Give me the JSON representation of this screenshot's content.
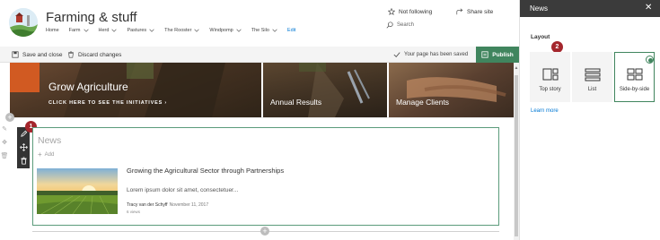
{
  "site": {
    "title": "Farming & stuff",
    "nav": [
      {
        "label": "Home",
        "has_dropdown": false
      },
      {
        "label": "Farm",
        "has_dropdown": true
      },
      {
        "label": "Herd",
        "has_dropdown": true
      },
      {
        "label": "Pastures",
        "has_dropdown": true
      },
      {
        "label": "The Rooster",
        "has_dropdown": true
      },
      {
        "label": "Windpomp",
        "has_dropdown": true
      },
      {
        "label": "The Silo",
        "has_dropdown": true
      },
      {
        "label": "Edit",
        "has_dropdown": false
      }
    ],
    "follow_label": "Not following",
    "share_label": "Share site",
    "search_placeholder": "Search"
  },
  "command_bar": {
    "save_close_label": "Save and close",
    "discard_label": "Discard changes",
    "saved_status": "Your page has been saved",
    "publish_label": "Publish"
  },
  "hero": {
    "main_title": "Grow Agriculture",
    "main_cta": "CLICK HERE TO SEE THE INITIATIVES",
    "tile_2_label": "Annual Results",
    "tile_3_label": "Manage Clients"
  },
  "news_webpart": {
    "title": "News",
    "add_label": "Add",
    "item": {
      "headline": "Growing the Agricultural Sector through Partnerships",
      "excerpt": "Lorem ipsum dolor sit amet, consectetuer...",
      "author": "Tracy van der Schyff",
      "date": "November 11, 2017",
      "views": "6 views"
    }
  },
  "badges": {
    "webpart_badge": "1",
    "layout_badge": "2"
  },
  "pane": {
    "title": "News",
    "close_icon": "close-icon",
    "layout_label": "Layout",
    "options": [
      {
        "label": "Top story",
        "icon": "top-story-layout-icon",
        "selected": false
      },
      {
        "label": "List",
        "icon": "list-layout-icon",
        "selected": false
      },
      {
        "label": "Side-by-side",
        "icon": "side-by-side-layout-icon",
        "selected": true
      }
    ],
    "learn_more": "Learn more"
  },
  "colors": {
    "accent_green": "#40855e",
    "badge_red": "#a4262c",
    "hero_orange": "#d15a22",
    "pane_header": "#3b3b3b",
    "link_blue": "#0078d4"
  }
}
